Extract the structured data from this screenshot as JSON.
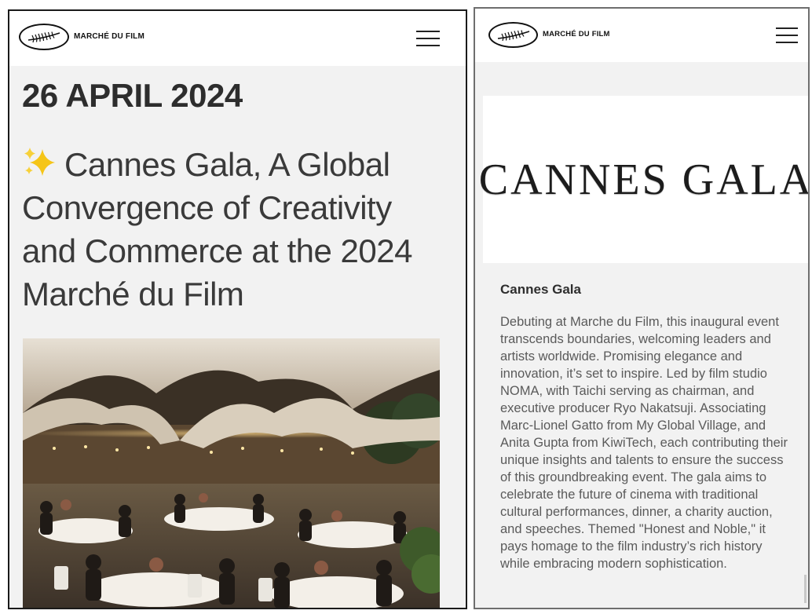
{
  "screens": {
    "left": {
      "header": {
        "logo_text": "MARCHÉ DU FILM",
        "logo_icon": "palm-leaf-icon",
        "menu_icon": "hamburger-menu-icon"
      },
      "article": {
        "date": "26 APRIL 2024",
        "title_emoji": "sparkles-icon",
        "title": "Cannes Gala, A Global Convergence of Creativity and Commerce at the 2024 Marché du Film",
        "image": "gala-dinner-photo"
      }
    },
    "right": {
      "header": {
        "logo_text": "MARCHÉ DU FILM",
        "logo_icon": "palm-leaf-icon",
        "menu_icon": "hamburger-menu-icon"
      },
      "banner": {
        "text": "CANNES GALA"
      },
      "section": {
        "heading": "Cannes Gala",
        "body": "Debuting at Marche du Film, this inaugural event transcends boundaries, welcoming leaders and artists worldwide. Promising elegance and innovation, it’s set to inspire. Led by film studio NOMA, with Taichi serving as chairman, and executive producer Ryo Nakatsuji. Associating Marc-Lionel Gatto from My Global Village, and Anita Gupta from KiwiTech, each contributing their unique insights and talents to ensure the success of this groundbreaking event. The gala aims to celebrate the future of cinema with traditional cultural performances, dinner, a charity auction, and speeches. Themed \"Honest and Noble,\" it pays homage to the film industry’s rich history while embracing modern sophistication."
      }
    }
  },
  "colors": {
    "page_bg": "#f2f2f2",
    "header_bg": "#ffffff",
    "title_text": "#3a3a3a",
    "body_text": "#5a5a5a",
    "frame_border": "#1a1a1a"
  }
}
